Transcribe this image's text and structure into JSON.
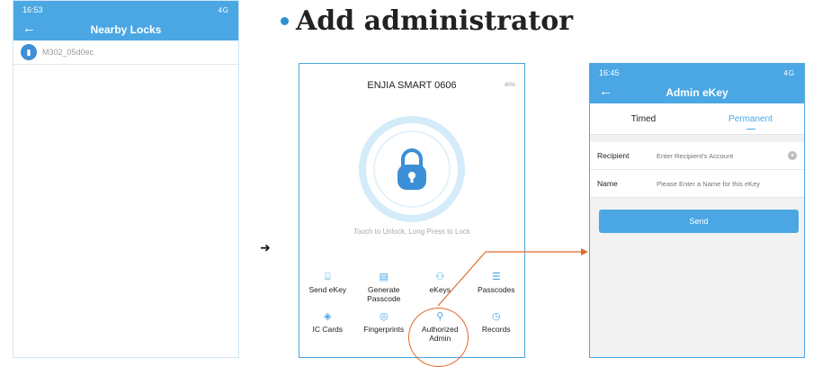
{
  "heading": "Add administrator",
  "screen1": {
    "time": "16:53",
    "signal": "4G",
    "title": "Nearby Locks",
    "back_icon": "←",
    "lock_item": "M302_05d0ec"
  },
  "screen2": {
    "device_name": "ENJIA SMART 0606",
    "battery": "40%",
    "hint": "Touch to Unlock, Long Press to Lock",
    "menu": [
      {
        "label": "Send eKey",
        "icon": "key-icon"
      },
      {
        "label": "Generate Passcode",
        "icon": "document-icon"
      },
      {
        "label": "eKeys",
        "icon": "people-icon"
      },
      {
        "label": "Passcodes",
        "icon": "list-icon"
      },
      {
        "label": "IC Cards",
        "icon": "card-icon"
      },
      {
        "label": "Fingerprints",
        "icon": "fingerprint-icon"
      },
      {
        "label": "Authorized Admin",
        "icon": "admin-icon"
      },
      {
        "label": "Records",
        "icon": "clock-icon"
      }
    ]
  },
  "screen3": {
    "time": "16:45",
    "signal": "4G",
    "title": "Admin eKey",
    "tabs": [
      "Timed",
      "Permanent"
    ],
    "recipient_label": "Recipient",
    "recipient_placeholder": "Enter Recipient's Account",
    "name_label": "Name",
    "name_placeholder": "Please Enter a Name for this eKey",
    "send_label": "Send"
  },
  "colors": {
    "accent": "#4aa7e4",
    "highlight": "#e06a2b"
  }
}
